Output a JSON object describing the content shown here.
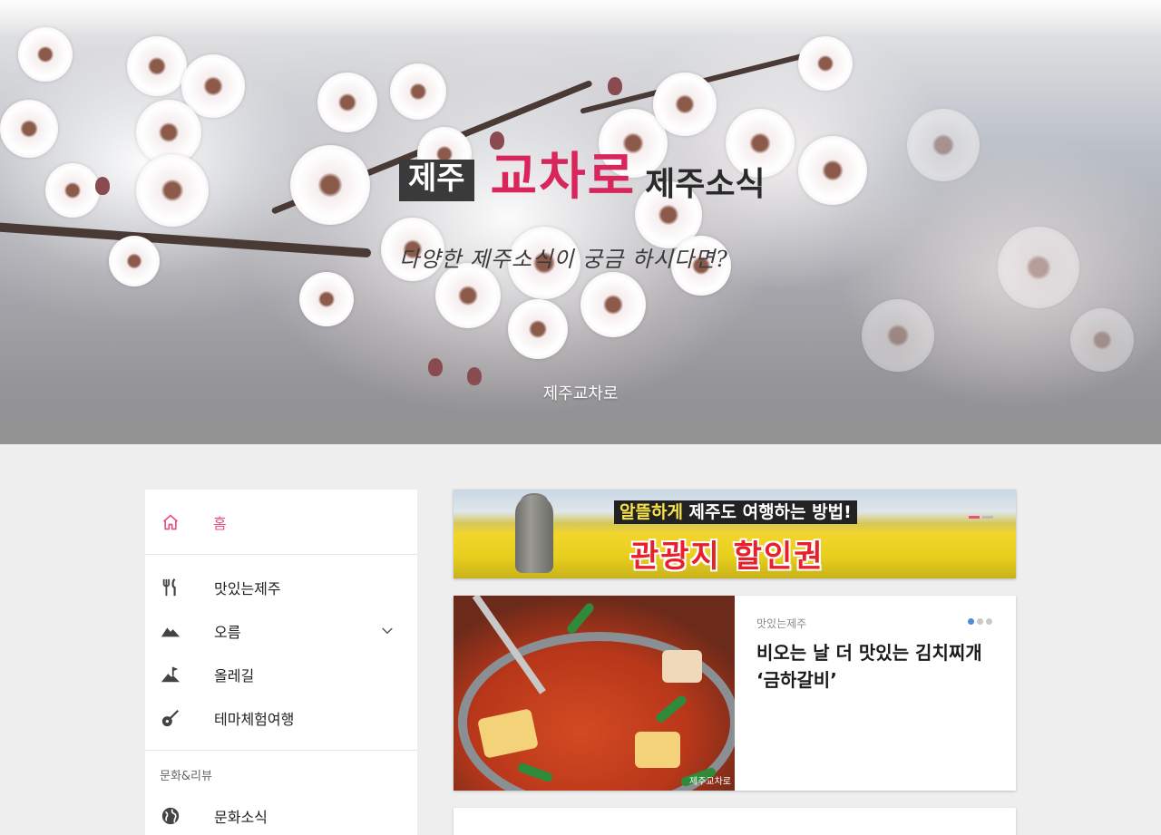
{
  "hero": {
    "logo_box": "제주",
    "logo_accent": "교차로",
    "logo_sub": "제주소식",
    "tagline": "다양한 제주소식이 궁금 하시다면?",
    "site_name": "제주교차로"
  },
  "sidebar": {
    "home": {
      "label": "홈",
      "icon": "home-icon"
    },
    "items": [
      {
        "label": "맛있는제주",
        "icon": "fork-knife-icon"
      },
      {
        "label": "오름",
        "icon": "mountain-icon",
        "expandable": true
      },
      {
        "label": "올레길",
        "icon": "flag-hill-icon"
      },
      {
        "label": "테마체험여행",
        "icon": "guitar-icon"
      }
    ],
    "section_heading": "문화&리뷰",
    "section_items": [
      {
        "label": "문화소식",
        "icon": "globe-icon"
      }
    ]
  },
  "banner": {
    "top_highlight": "알뜰하게",
    "top_rest": " 제주도 여행하는 방법!",
    "main": "관광지 할인권"
  },
  "featured": {
    "category": "맛있는제주",
    "title": "비오는 날 더 맛있는 김치찌개 ‘금하갈비’",
    "watermark": "제주교차로"
  },
  "colors": {
    "accent_pink": "#e8508c",
    "logo_red": "#d8255c",
    "dot_active_blue": "#4a8cd8"
  }
}
